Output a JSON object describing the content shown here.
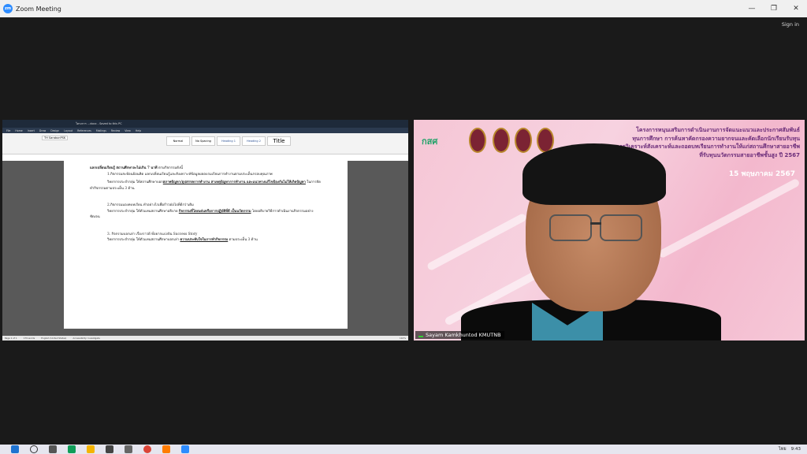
{
  "window": {
    "title": "Zoom Meeting",
    "sign_in": "Sign in"
  },
  "word": {
    "doc_title": "โครงการ ...docx - Saved to this PC",
    "tabs": [
      "File",
      "Home",
      "Insert",
      "Draw",
      "Design",
      "Layout",
      "References",
      "Mailings",
      "Review",
      "View",
      "Help"
    ],
    "font_name": "TH SarabunPSK",
    "styles": [
      "Normal",
      "No Spacing",
      "Heading 1",
      "Heading 2",
      "Title"
    ],
    "status_page": "Page 1 of 1",
    "status_words": "179 words",
    "status_lang": "English (United States)",
    "status_access": "Accessibility: Investigate",
    "status_zoom": "110%"
  },
  "document": {
    "heading": "แลกเปลี่ยนเรียนรู้ สถานศึกษาละไม่เกิน 7 นาที",
    "heading_tail": " ตามกิจกรรมดังนี้",
    "p1": "1.กิจกรรมสะท้อนย้อนคิด แลกเปลี่ยนเรียนรู้และสังเคราะห์ข้อมูลผลอบรมเรียนการทำงานตามประเด็นกรอบคุณภาพ",
    "p1b_pre": "วิทยากรประจำกลุ่ม ให้สถานศึกษาบอก",
    "p1b_ul": "สภาพปัญหา/อุปสรรคการทำงาน สาเหตุปัญหาการทำงาน และแนวทางแก้ไขป้องกันไม่ให้เกิดปัญหา",
    "p1b_post": " ในการจัดทำกิจกรรมตามประเด็น 3 ด้าน",
    "p2": "2.กิจกรรมมองคบทเรียน ทำอย่างไรเพื่อก้าวต่อไปที่ดีกว่าเดิม",
    "p2b_pre": "วิทยากรประจำกลุ่ม ให้ตัวแทนสถานศึกษาอธิบาย ",
    "p2b_ul": "กิจกรรมที่โดดเด่นหรือการปฏิบัติที่ดี เป็นนวัตกรรม",
    "p2b_post": " โดยอธิบายวิธีการดำเนินงานกิจกรรมอย่างชัดเจน",
    "p3": "3. กิจกรรมบอกเล่า เรื่องราวดี ที่อยากแบ่งปัน Success Story",
    "p3b_pre": "วิทยากรประจำกลุ่ม ให้ตัวแทนสถานศึกษาบอกเล่า ",
    "p3b_ul": "ความประทับใจในการทำกิจกรรม",
    "p3b_post": " ตามประเด็น 3 ด้าน"
  },
  "camera": {
    "logo": "กสศ",
    "banner_lines": [
      "โครงการหนุนเสริมการดำเนินงานการจัดแนะแนวและประกาศสัมพันธ์",
      "ทุนการศึกษา การค้นหาคัดกรองความยากจนและคัดเลือกนักเรียนรับทุน",
      "การวิเคราะห์สังเคราะห์และถอดบทเรียนการทำงานให้แก่สถานศึกษาสายอาชีพ",
      "ที่รับทุนนวัตกรรมสายอาชีพชั้นสูง ปี 2567"
    ],
    "date": "15 พฤษภาคม 2567",
    "participant_name": "Sayam Kamkhuntod KMUTNB"
  },
  "taskbar": {
    "time": "9:43",
    "lang": "ไทย"
  }
}
